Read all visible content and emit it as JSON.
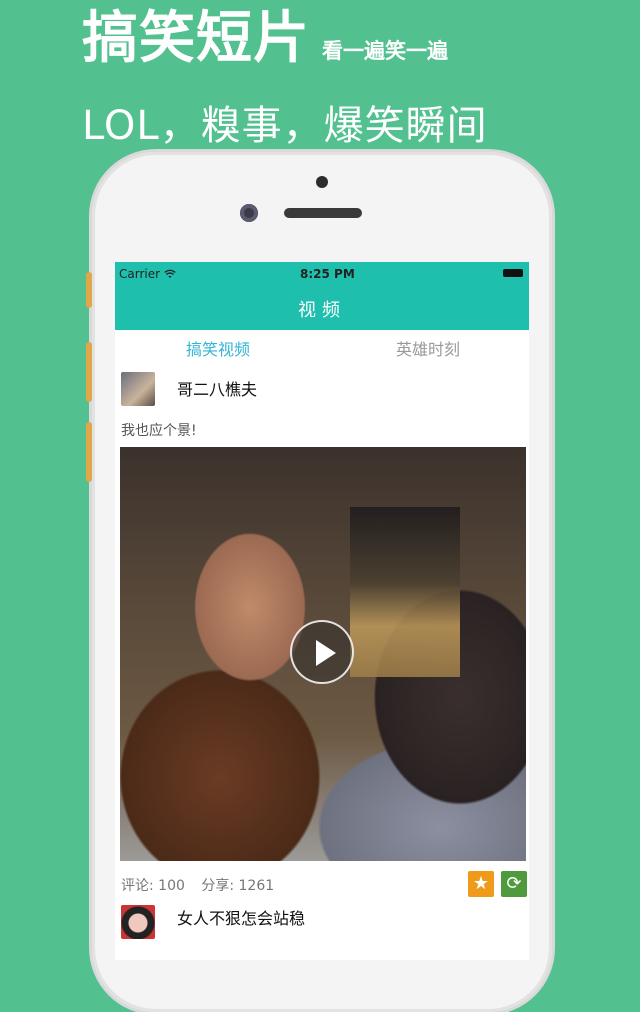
{
  "promo": {
    "title": "搞笑短片",
    "subtitle": "看一遍笑一遍",
    "tagline": "LOL，糗事，爆笑瞬间"
  },
  "status_bar": {
    "carrier": "Carrier ",
    "wifi_icon": "wifi-icon",
    "time": "8:25 PM"
  },
  "navbar": {
    "title": "视频"
  },
  "tabs": [
    {
      "label": "搞笑视频",
      "active": true
    },
    {
      "label": "英雄时刻",
      "active": false
    }
  ],
  "posts": [
    {
      "username": "哥二八樵夫",
      "text": "我也应个景!",
      "comments_label": "评论: 100",
      "shares_label": "分享: 1261",
      "actions": {
        "favorite_icon": "★",
        "refresh_icon": "⟳"
      }
    },
    {
      "username": "女人不狠怎会站稳"
    }
  ],
  "colors": {
    "background": "#52c08f",
    "nav": "#1fbfae",
    "active_tab": "#32b6d6",
    "favorite": "#ef9a1b",
    "refresh": "#4f9a3c"
  }
}
